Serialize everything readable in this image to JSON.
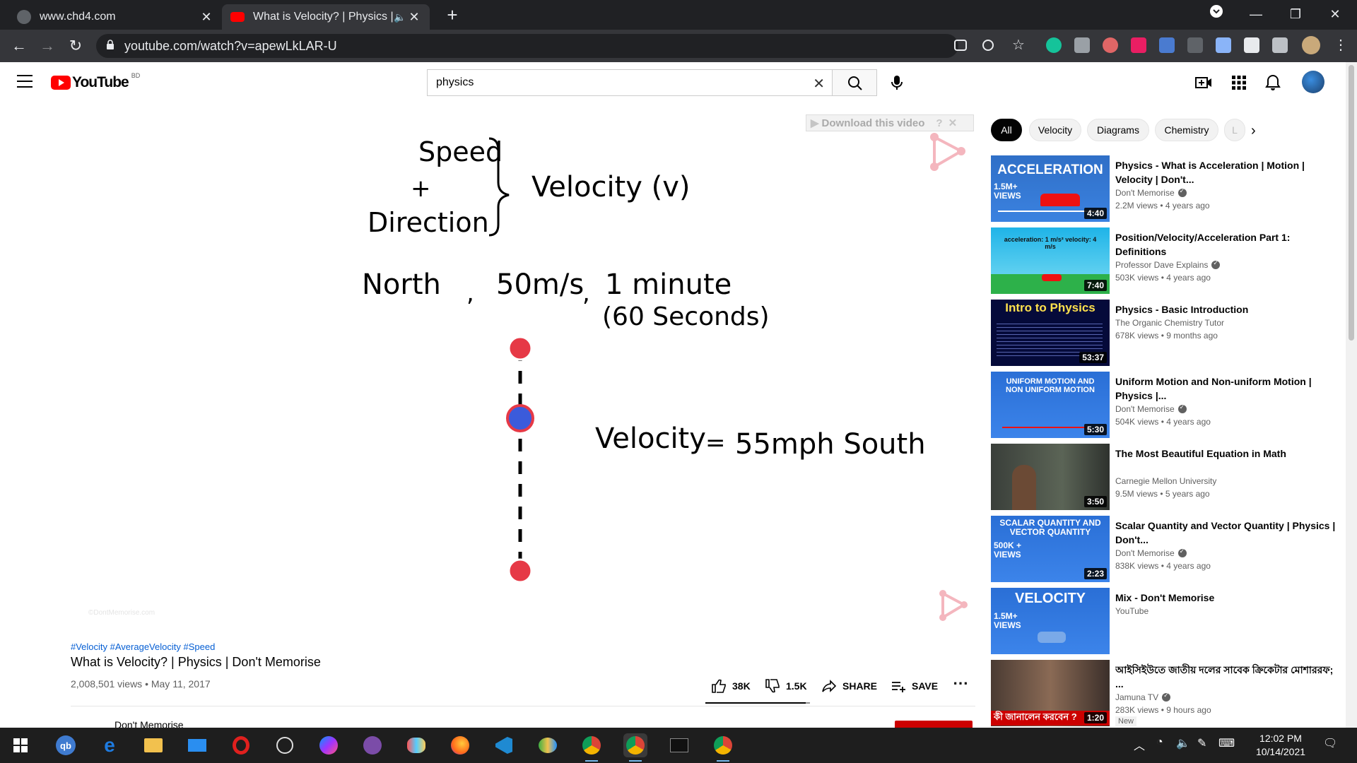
{
  "browser": {
    "tabs": [
      {
        "title": "www.chd4.com",
        "active": false
      },
      {
        "title": "What is Velocity? | Physics | Don't Memorise",
        "active": true
      }
    ],
    "url": "youtube.com/watch?v=apewLkLAR-U"
  },
  "youtube": {
    "logo_text": "YouTube",
    "country_code": "BD",
    "search_value": "physics"
  },
  "player": {
    "download_bar": "Download this video",
    "slide": {
      "line1": "Speed",
      "plus": "+",
      "line3": "Direction",
      "velocity_label": "Velocity (v)",
      "north": "North",
      "comma": ",",
      "speed_val": "50m/s",
      "time_val": "1 minute",
      "seconds": "(60 Seconds)",
      "velocity": "Velocity",
      "equals": "=",
      "answer": "55mph South"
    },
    "watermark": "©DontMemorise.com"
  },
  "video": {
    "hashtags": "#Velocity #AverageVelocity #Speed",
    "title": "What is Velocity? | Physics | Don't Memorise",
    "meta": "2,008,501 views • May 11, 2017",
    "likes": "38K",
    "dislikes": "1.5K",
    "share": "SHARE",
    "save": "SAVE",
    "like_ratio": 0.96,
    "channel": "Don't Memorise"
  },
  "chips": [
    "All",
    "Velocity",
    "Diagrams",
    "Chemistry",
    "L"
  ],
  "recommendations": [
    {
      "title": "Physics - What is Acceleration | Motion | Velocity | Don't...",
      "channel": "Don't Memorise",
      "verified": true,
      "stats": "2.2M views • 4 years ago",
      "duration": "4:40",
      "thumb_text": "ACCELERATION",
      "badge": "1.5M+ VIEWS"
    },
    {
      "title": "Position/Velocity/Acceleration Part 1: Definitions",
      "channel": "Professor Dave Explains",
      "verified": true,
      "stats": "503K views • 4 years ago",
      "duration": "7:40",
      "thumb_text": "acceleration: 1 m/s²   velocity: 4 m/s",
      "badge": ""
    },
    {
      "title": "Physics - Basic Introduction",
      "channel": "The Organic Chemistry Tutor",
      "verified": false,
      "stats": "678K views • 9 months ago",
      "duration": "53:37",
      "thumb_text": "Intro to Physics",
      "badge": ""
    },
    {
      "title": "Uniform Motion and Non-uniform Motion | Physics |...",
      "channel": "Don't Memorise",
      "verified": true,
      "stats": "504K views • 4 years ago",
      "duration": "5:30",
      "thumb_text": "UNIFORM MOTION AND NON UNIFORM MOTION",
      "badge": ""
    },
    {
      "title": "The Most Beautiful Equation in Math",
      "channel": "Carnegie Mellon University",
      "verified": false,
      "stats": "9.5M views • 5 years ago",
      "duration": "3:50",
      "thumb_text": "",
      "badge": ""
    },
    {
      "title": "Scalar Quantity and Vector Quantity | Physics | Don't...",
      "channel": "Don't Memorise",
      "verified": true,
      "stats": "838K views • 4 years ago",
      "duration": "2:23",
      "thumb_text": "SCALAR QUANTITY AND VECTOR QUANTITY",
      "badge": "500K + VIEWS"
    },
    {
      "title": "Mix - Don't Memorise",
      "channel": "YouTube",
      "verified": false,
      "stats": "",
      "duration": "",
      "thumb_text": "VELOCITY",
      "badge": "1.5M+ VIEWS"
    },
    {
      "title": "আইসিইউতে জাতীয় দলের সাবেক ক্রিকেটার মোশাররফ; ...",
      "channel": "Jamuna TV",
      "verified": true,
      "stats": "283K views • 9 hours ago",
      "duration": "1:20",
      "thumb_text": "কী জানালেন করবেন ?",
      "badge": "",
      "new_label": "New"
    }
  ],
  "taskbar": {
    "time": "12:02 PM",
    "date": "10/14/2021",
    "icons": [
      "windows-start",
      "qbittorrent",
      "edge",
      "file-explorer",
      "mail",
      "opera",
      "satellite-app",
      "messenger",
      "github-desktop",
      "paint-app",
      "firefox",
      "vscode",
      "earth-app",
      "chrome",
      "chrome-active",
      "terminal",
      "chrome-profile"
    ]
  },
  "colors": {
    "brand_red": "#ff0000",
    "chrome_dark": "#202124",
    "link_blue": "#065fd4",
    "dot_red": "#e63946",
    "dot_blue": "#3b5bdb"
  }
}
